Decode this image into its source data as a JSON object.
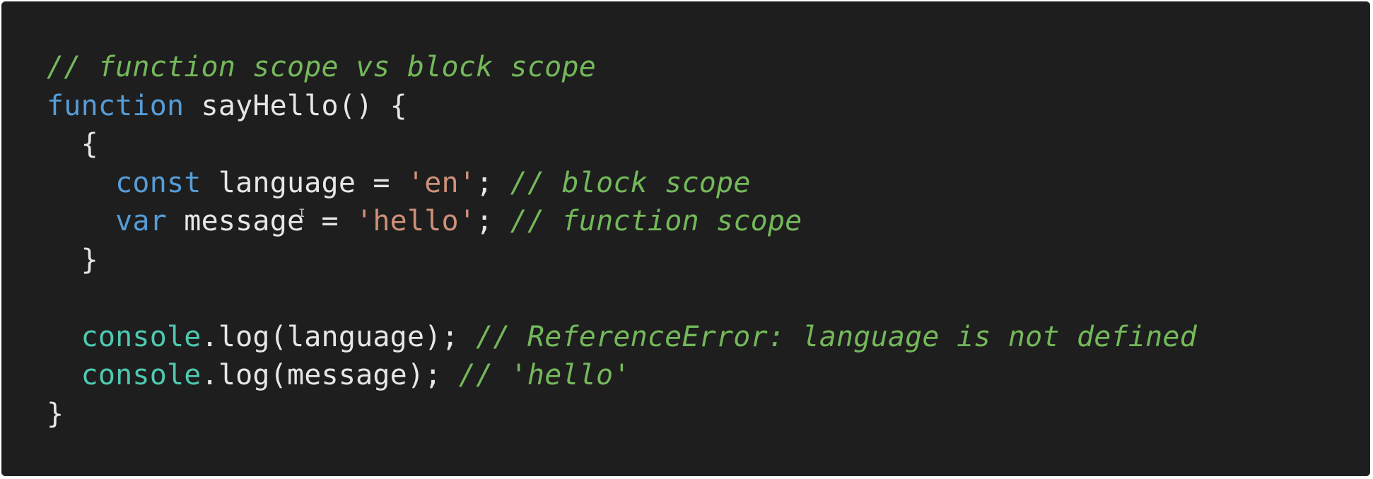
{
  "colors": {
    "background": "#1e1e1e",
    "comment": "#74b85a",
    "keyword": "#569cd6",
    "string": "#ce9178",
    "console": "#4ec9b0",
    "text": "#e6e6e6"
  },
  "code": {
    "line1": {
      "comment": "// function scope vs block scope"
    },
    "line2": {
      "keyword": "function",
      "rest": " sayHello() {"
    },
    "line3": {
      "indent": "  ",
      "brace": "{"
    },
    "line4": {
      "indent": "    ",
      "keyword": "const",
      "ident": " language = ",
      "string": "'en'",
      "semi": "; ",
      "comment": "// block scope"
    },
    "line5": {
      "indent": "    ",
      "keyword": "var",
      "ident": " message = ",
      "string": "'hello'",
      "semi": "; ",
      "comment": "// function scope"
    },
    "line6": {
      "indent": "  ",
      "brace": "}"
    },
    "line7": {
      "blank": ""
    },
    "line8": {
      "indent": "  ",
      "console": "console",
      "rest": ".log(language); ",
      "comment": "// ReferenceError: language is not defined"
    },
    "line9": {
      "indent": "  ",
      "console": "console",
      "rest": ".log(message); ",
      "comment": "// 'hello'"
    },
    "line10": {
      "brace": "}"
    }
  },
  "cursor_glyph": "I"
}
